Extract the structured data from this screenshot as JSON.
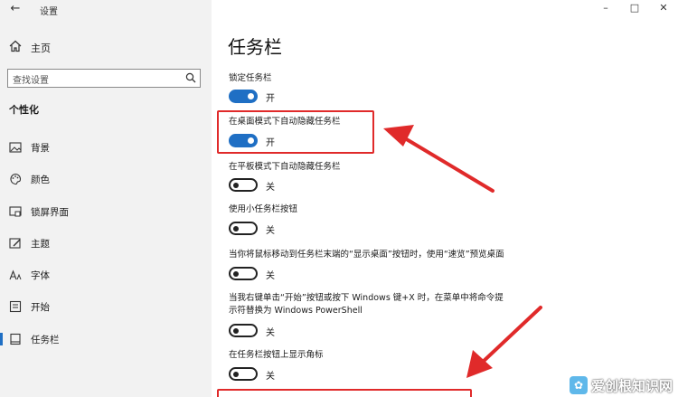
{
  "window": {
    "back_icon": "back-arrow-icon",
    "title": "设置"
  },
  "sidebar": {
    "home_label": "主页",
    "search_placeholder": "查找设置",
    "section_label": "个性化",
    "items": [
      {
        "label": "背景",
        "icon": "image-icon"
      },
      {
        "label": "颜色",
        "icon": "palette-icon"
      },
      {
        "label": "锁屏界面",
        "icon": "lockscreen-icon"
      },
      {
        "label": "主题",
        "icon": "theme-brush-icon"
      },
      {
        "label": "字体",
        "icon": "font-icon"
      },
      {
        "label": "开始",
        "icon": "start-icon"
      },
      {
        "label": "任务栏",
        "icon": "taskbar-icon",
        "selected": true
      }
    ]
  },
  "main": {
    "title": "任务栏",
    "settings": [
      {
        "label": "锁定任务栏",
        "state": "开",
        "on": true
      },
      {
        "label": "在桌面模式下自动隐藏任务栏",
        "state": "开",
        "on": true
      },
      {
        "label": "在平板模式下自动隐藏任务栏",
        "state": "关",
        "on": false
      },
      {
        "label": "使用小任务栏按钮",
        "state": "关",
        "on": false
      },
      {
        "label": "当你将鼠标移动到任务栏末端的“显示桌面”按钮时，使用“速览”预览桌面",
        "state": "关",
        "on": false
      },
      {
        "label_line1": "当我右键单击“开始”按钮或按下 Windows 键+X 时，在菜单中将命令提",
        "label_line2": "示符替换为 Windows PowerShell",
        "state": "关",
        "on": false
      },
      {
        "label": "在任务栏按钮上显示角标",
        "state": "关",
        "on": false
      }
    ]
  },
  "annotations": {
    "color": "#e02a2a"
  },
  "watermark": {
    "text": "爱创根知识网"
  },
  "colors": {
    "accent": "#1f6fc4",
    "sidebar_bg": "#f2f2f2"
  }
}
